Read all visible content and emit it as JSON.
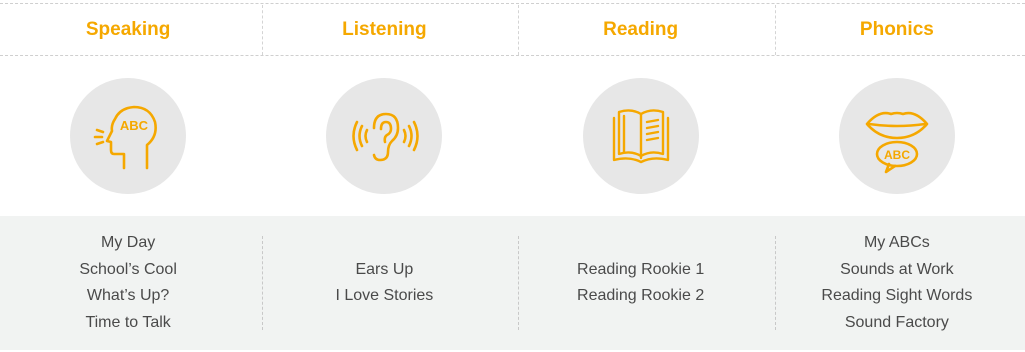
{
  "columns": [
    {
      "title": "Speaking",
      "icon": "speaking-head-icon",
      "icon_text": "ABC",
      "items": [
        "My Day",
        "School’s Cool",
        "What’s Up?",
        "Time to Talk"
      ]
    },
    {
      "title": "Listening",
      "icon": "ear-sound-icon",
      "items": [
        "Ears Up",
        "I Love Stories"
      ]
    },
    {
      "title": "Reading",
      "icon": "open-book-icon",
      "items": [
        "Reading Rookie 1",
        "Reading Rookie 2"
      ]
    },
    {
      "title": "Phonics",
      "icon": "lips-speech-icon",
      "icon_text": "ABC",
      "items": [
        "My ABCs",
        "Sounds at Work",
        "Reading Sight Words",
        "Sound Factory"
      ]
    }
  ],
  "colors": {
    "accent": "#f5a800",
    "circle": "#e7e7e7",
    "panel": "#f1f3f2",
    "text": "#4a4a4a"
  }
}
